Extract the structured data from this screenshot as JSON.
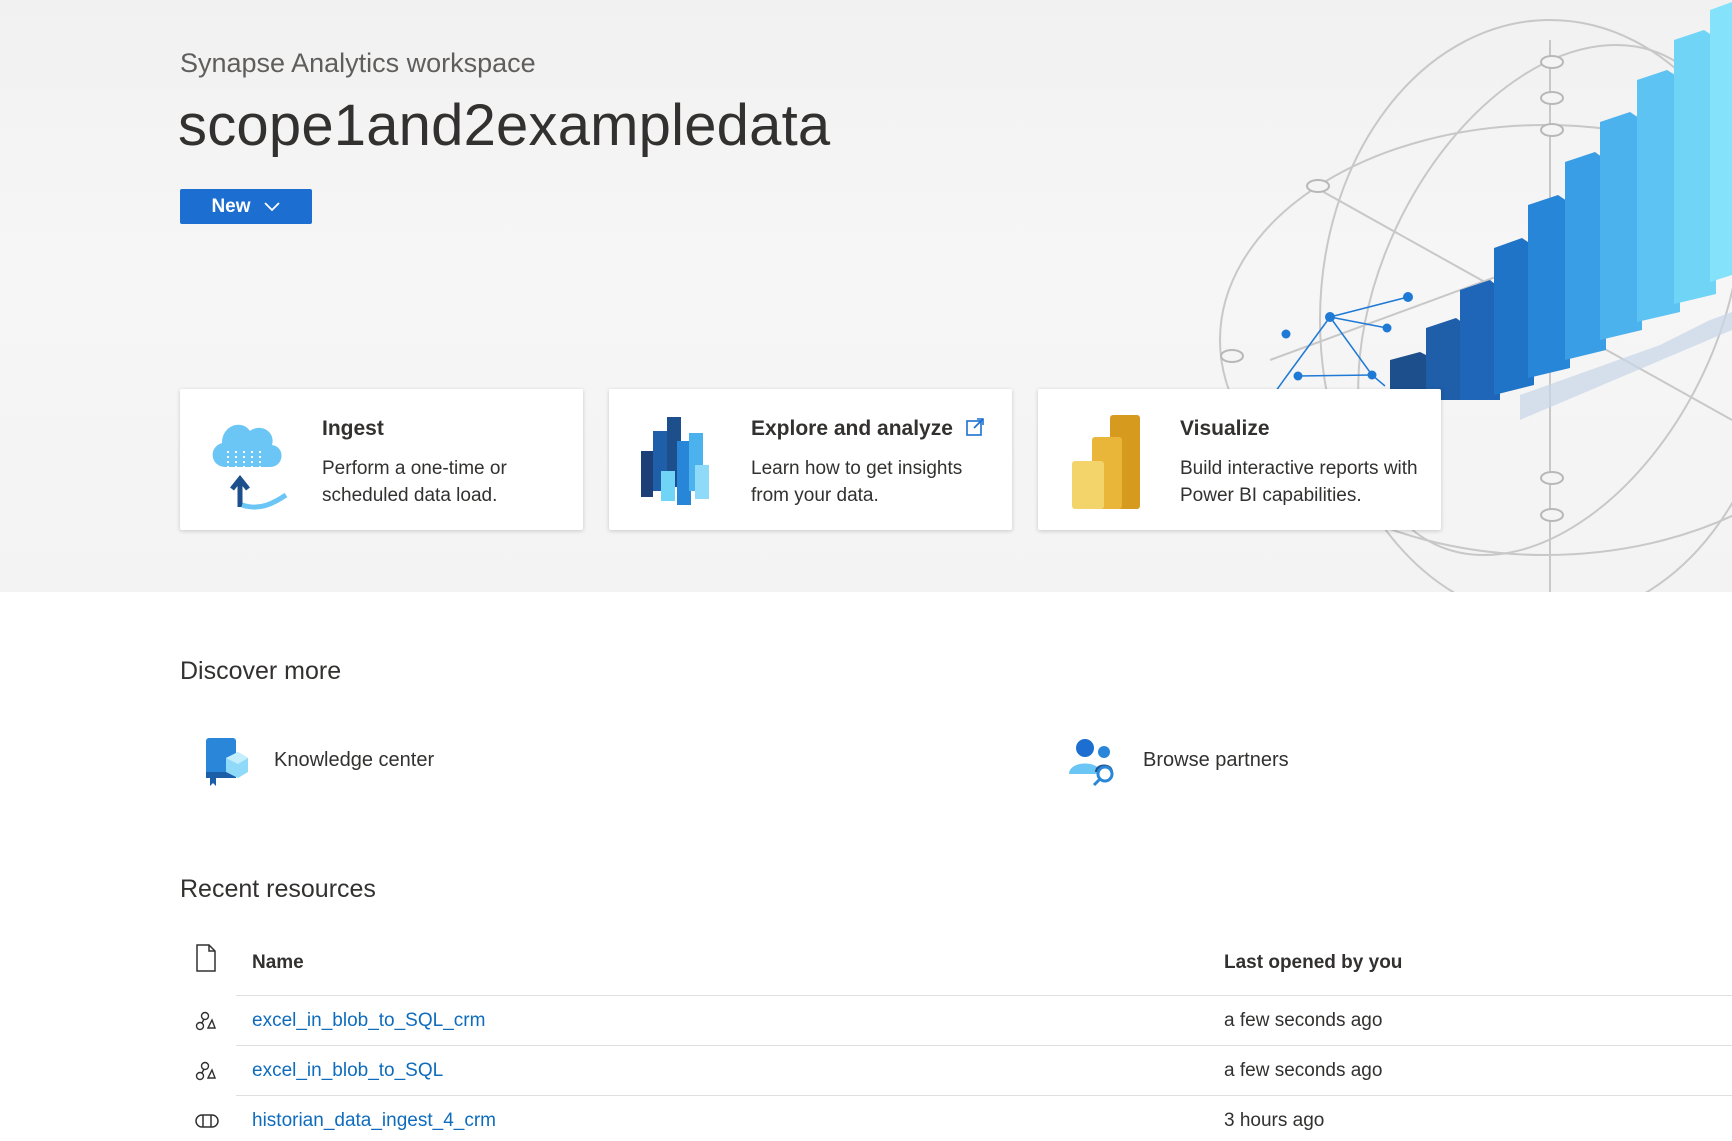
{
  "header": {
    "subtitle": "Synapse Analytics workspace",
    "title": "scope1and2exampledata",
    "new_button_label": "New"
  },
  "cards": [
    {
      "title": "Ingest",
      "description": "Perform a one-time or scheduled data load."
    },
    {
      "title": "Explore and analyze",
      "description": "Learn how to get insights from your data."
    },
    {
      "title": "Visualize",
      "description": "Build interactive reports with Power BI capabilities."
    }
  ],
  "discover": {
    "heading": "Discover more",
    "links": [
      {
        "label": "Knowledge center",
        "icon": "book-icon"
      },
      {
        "label": "Browse partners",
        "icon": "partners-icon"
      }
    ]
  },
  "recent": {
    "heading": "Recent resources",
    "columns": {
      "name": "Name",
      "last_opened": "Last opened by you"
    },
    "rows": [
      {
        "name": "excel_in_blob_to_SQL_crm",
        "last_opened": "a few seconds ago",
        "icon": "dataflow-icon"
      },
      {
        "name": "excel_in_blob_to_SQL",
        "last_opened": "a few seconds ago",
        "icon": "dataflow-icon"
      },
      {
        "name": "historian_data_ingest_4_crm",
        "last_opened": "3 hours ago",
        "icon": "pipeline-icon"
      }
    ]
  },
  "colors": {
    "accent": "#1c6fd0",
    "link": "#0f6cbd",
    "hero_bg": "#f3f3f3"
  }
}
